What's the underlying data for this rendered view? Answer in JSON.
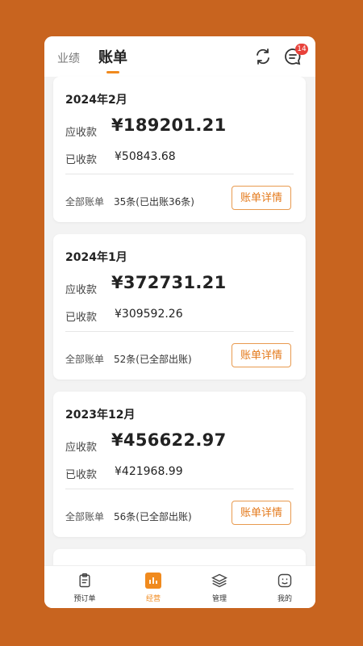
{
  "header": {
    "tab_inactive": "业绩",
    "tab_active": "账单",
    "badge": "14"
  },
  "cards": [
    {
      "month": "2024年2月",
      "receivable_label": "应收款",
      "receivable": "¥189201.21",
      "received_label": "已收款",
      "received": "¥50843.68",
      "all_label": "全部账单",
      "all_value": "35条(已出账36条)",
      "button": "账单详情"
    },
    {
      "month": "2024年1月",
      "receivable_label": "应收款",
      "receivable": "¥372731.21",
      "received_label": "已收款",
      "received": "¥309592.26",
      "all_label": "全部账单",
      "all_value": "52条(已全部出账)",
      "button": "账单详情"
    },
    {
      "month": "2023年12月",
      "receivable_label": "应收款",
      "receivable": "¥456622.97",
      "received_label": "已收款",
      "received": "¥421968.99",
      "all_label": "全部账单",
      "all_value": "56条(已全部出账)",
      "button": "账单详情"
    }
  ],
  "tabbar": {
    "items": [
      {
        "label": "预订单",
        "icon": "clipboard-icon"
      },
      {
        "label": "经营",
        "icon": "bar-chart-icon"
      },
      {
        "label": "管理",
        "icon": "layers-icon"
      },
      {
        "label": "我的",
        "icon": "face-icon"
      }
    ],
    "active_color": "#f08a1e"
  },
  "colors": {
    "background": "#c8641f",
    "accent": "#f08a1e",
    "badge": "#e8423b"
  }
}
